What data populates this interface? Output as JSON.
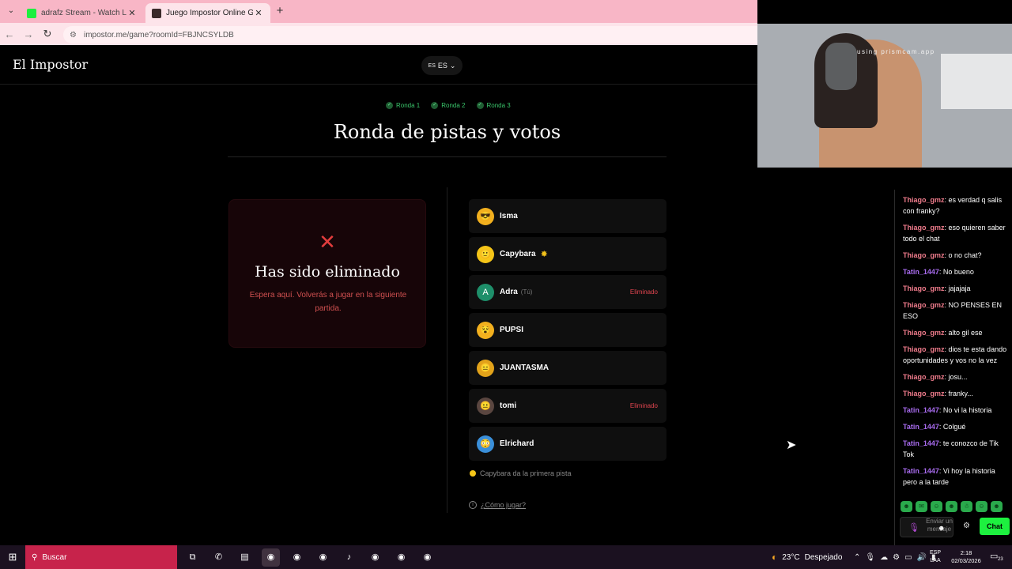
{
  "browser": {
    "tabs": [
      {
        "title": "adrafz Stream - Watch Live on Kick",
        "active": false,
        "favicon_color": "#1df03f"
      },
      {
        "title": "Juego Impostor Online Gratis",
        "active": true,
        "favicon_color": "#3a2a2a"
      }
    ],
    "url": "impostor.me/game?roomId=FBJNCSYLDB",
    "nav": {
      "back": "←",
      "forward": "→",
      "reload": "↻",
      "site_icon": "⚙",
      "menu": "⌄",
      "new_tab": "+",
      "close": "✕"
    }
  },
  "site": {
    "logo": "El Impostor",
    "language": {
      "flag": "ES",
      "code": "ES",
      "chevron": "⌄"
    }
  },
  "game": {
    "rounds": [
      {
        "label": "Ronda 1",
        "done": true
      },
      {
        "label": "Ronda 2",
        "done": true
      },
      {
        "label": "Ronda 3",
        "done": true
      }
    ],
    "title": "Ronda de pistas y votos",
    "eliminated_card": {
      "icon": "✕",
      "title": "Has sido eliminado",
      "message": "Espera aquí. Volverás a jugar en la siguiente partida."
    },
    "players": [
      {
        "name": "Isma",
        "avatar": "😎",
        "avatar_bg": "#f2b01e",
        "you_label": "",
        "status": "",
        "star": "",
        "online": false
      },
      {
        "name": "Capybara",
        "avatar": "🙂",
        "avatar_bg": "#f5c518",
        "you_label": "",
        "status": "",
        "star": "✸",
        "online": false
      },
      {
        "name": "Adra",
        "avatar": "A",
        "avatar_bg": "#1e8f6a",
        "you_label": "(Tú)",
        "status": "Eliminado",
        "star": "",
        "online": false
      },
      {
        "name": "PUPSI",
        "avatar": "😵",
        "avatar_bg": "#f2b01e",
        "you_label": "",
        "status": "",
        "star": "",
        "online": true
      },
      {
        "name": "JUANTASMA",
        "avatar": "😑",
        "avatar_bg": "#e2a31a",
        "you_label": "",
        "status": "",
        "star": "",
        "online": false
      },
      {
        "name": "tomi",
        "avatar": "😐",
        "avatar_bg": "#5a4640",
        "you_label": "",
        "status": "Eliminado",
        "star": "",
        "online": false
      },
      {
        "name": "Elrichard",
        "avatar": "😳",
        "avatar_bg": "#3a8fd9",
        "you_label": "",
        "status": "",
        "star": "",
        "online": false
      }
    ],
    "hint": "Capybara da la primera pista",
    "howto": {
      "icon": "i",
      "label": "¿Cómo jugar?"
    }
  },
  "webcam": {
    "overlay_text": "using prismcam.app"
  },
  "chat": {
    "messages": [
      {
        "user": "Thiago_gmz",
        "color": "#f07c8c",
        "text": "es verdad q salis con franky?"
      },
      {
        "user": "Thiago_gmz",
        "color": "#f07c8c",
        "text": "eso quieren saber todo el chat"
      },
      {
        "user": "Thiago_gmz",
        "color": "#f07c8c",
        "text": "o no chat?"
      },
      {
        "user": "Tatin_1447",
        "color": "#a96cf0",
        "text": "No bueno"
      },
      {
        "user": "Thiago_gmz",
        "color": "#f07c8c",
        "text": "jajajaja"
      },
      {
        "user": "Thiago_gmz",
        "color": "#f07c8c",
        "text": "NO PENSES EN ESO"
      },
      {
        "user": "Thiago_gmz",
        "color": "#f07c8c",
        "text": "alto gil ese"
      },
      {
        "user": "Thiago_gmz",
        "color": "#f07c8c",
        "text": "dios te esta dando oportunidades y vos no la vez"
      },
      {
        "user": "Thiago_gmz",
        "color": "#f07c8c",
        "text": "josu..."
      },
      {
        "user": "Thiago_gmz",
        "color": "#f07c8c",
        "text": "franky..."
      },
      {
        "user": "Tatin_1447",
        "color": "#a96cf0",
        "text": "No vi la historia"
      },
      {
        "user": "Tatin_1447",
        "color": "#a96cf0",
        "text": "Colgué"
      },
      {
        "user": "Tatin_1447",
        "color": "#a96cf0",
        "text": "te conozco de Tik Tok"
      },
      {
        "user": "Tatin_1447",
        "color": "#a96cf0",
        "text": "Vi hoy la historia pero a la tarde"
      }
    ],
    "emotes": [
      "☻",
      "✉",
      "☺",
      "☻",
      "☃",
      "☺",
      "☻"
    ],
    "input_placeholder": "Enviar un mensaje",
    "send_label": "Chat"
  },
  "taskbar": {
    "search_label": "Buscar",
    "apps": [
      "⧉",
      "✆",
      "▤",
      "◉",
      "◉",
      "◉",
      "♪",
      "◉",
      "◉",
      "◉"
    ],
    "weather": {
      "temp": "23°C",
      "condition": "Despejado"
    },
    "lang": {
      "line1": "ESP",
      "line2": "LAA"
    },
    "time": "2:18",
    "date": "02/03/2026",
    "notif_count": "23"
  }
}
